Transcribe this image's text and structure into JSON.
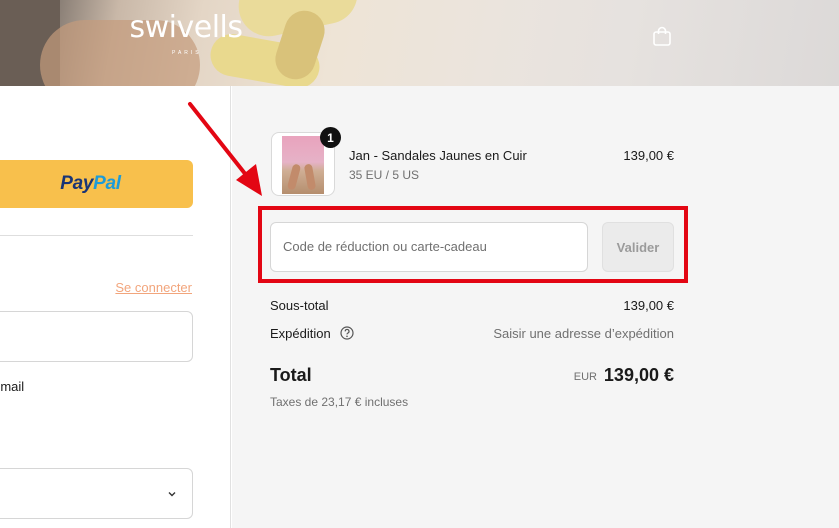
{
  "header": {
    "logo": "swivells",
    "logo_sub": "PARIS",
    "cart_icon": "shopping-bag-icon"
  },
  "left": {
    "paypal_pay": "Pay",
    "paypal_pal": "Pal",
    "login_link": "Se connecter",
    "email_note": "-mail"
  },
  "order": {
    "quantity": "1",
    "product_name": "Jan - Sandales Jaunes en Cuir",
    "product_variant": "35 EU / 5 US",
    "product_price": "139,00 €"
  },
  "discount": {
    "placeholder": "Code de réduction ou carte-cadeau",
    "apply_label": "Valider"
  },
  "summary": {
    "subtotal_label": "Sous-total",
    "subtotal_value": "139,00 €",
    "shipping_label": "Expédition",
    "shipping_value": "Saisir une adresse d’expédition",
    "total_label": "Total",
    "currency": "EUR",
    "total_value": "139,00 €",
    "taxes": "Taxes de 23,17 € incluses"
  },
  "colors": {
    "paypal_yellow": "#f8c04c",
    "link_accent": "#f2a57c",
    "annotation_red": "#e30613"
  }
}
